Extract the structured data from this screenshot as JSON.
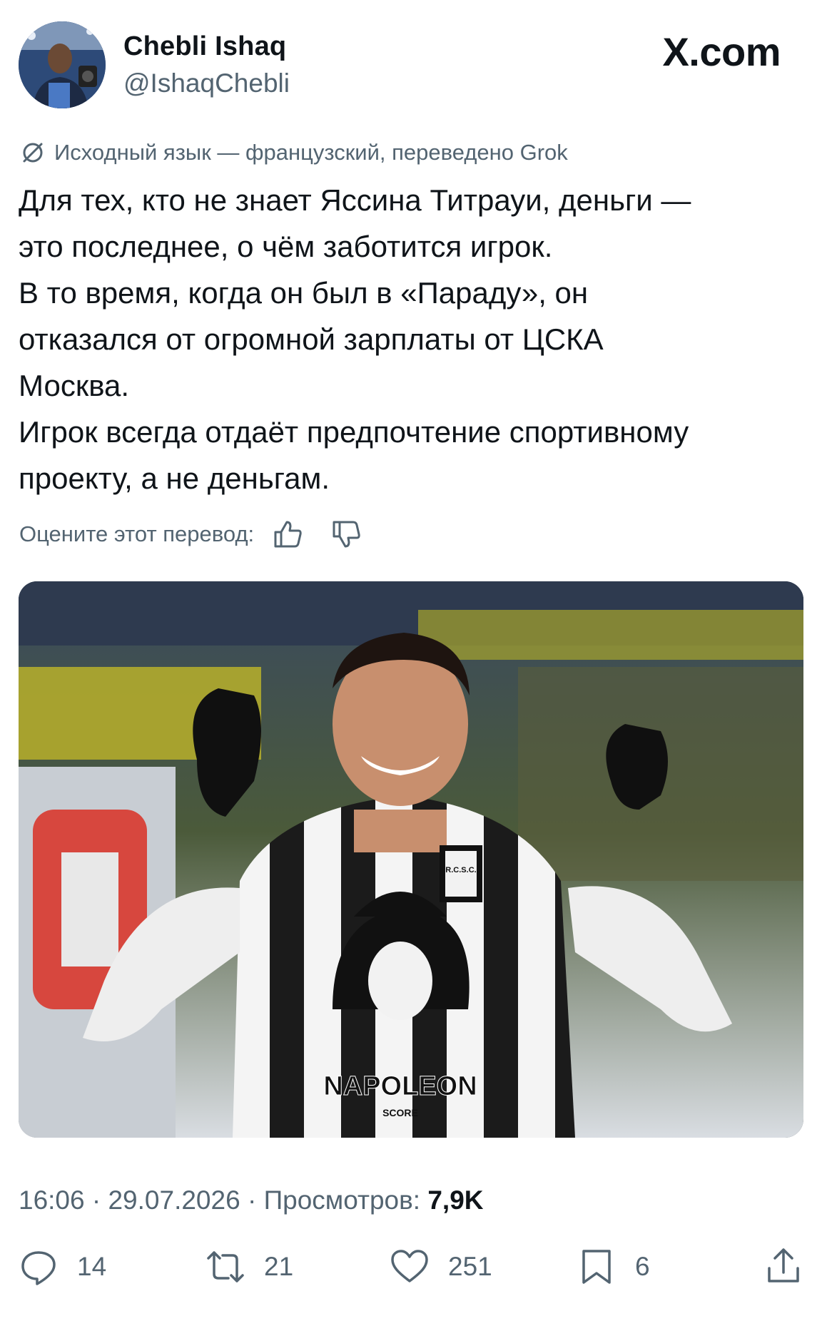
{
  "author": {
    "name": "Chebli Ishaq",
    "handle": "@IshaqChebli"
  },
  "brand": "X.com",
  "translation_note": "Исходный язык — французский, переведено Grok",
  "tweet_text": "Для тех, кто не знает Яссина Титрауи, деньги —\nэто последнее, о чём заботится игрок.\nВ то время, когда он был в «Параду», он\nотказался от огромной зарплаты от ЦСКА\nМосква.\nИгрок всегда отдаёт предпочтение спортивному\nпроекту, а не деньгам.",
  "rate_translation_label": "Оцените этот перевод:",
  "media": {
    "club_crest_text": "R.C.S.C.",
    "sponsor_text": "NAPOLEON",
    "sponsor_subtext": "SCORE"
  },
  "meta": {
    "time": "16:06",
    "date": "29.07.2026",
    "views_label": "Просмотров:",
    "views_value": "7,9K"
  },
  "actions": {
    "replies": "14",
    "reposts": "21",
    "likes": "251",
    "bookmarks": "6"
  },
  "icons": {
    "translate": "translate-icon",
    "thumb_up": "thumbs-up-icon",
    "thumb_down": "thumbs-down-icon",
    "reply": "reply-icon",
    "repost": "repost-icon",
    "like": "heart-icon",
    "bookmark": "bookmark-icon",
    "share": "share-icon"
  },
  "colors": {
    "text_primary": "#0f1419",
    "text_secondary": "#536471"
  }
}
